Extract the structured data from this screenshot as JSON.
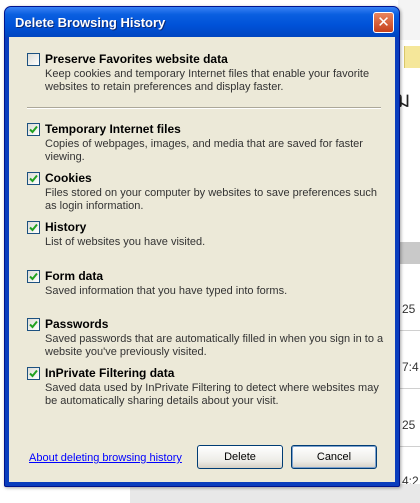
{
  "dialog": {
    "title": "Delete Browsing History",
    "close_symbol": "✕",
    "options": [
      {
        "label": "Preserve Favorites website data",
        "checked": false,
        "description": "Keep cookies and temporary Internet files that enable your favorite websites to retain preferences and display faster."
      },
      {
        "label": "Temporary Internet files",
        "checked": true,
        "description": "Copies of webpages, images, and media that are saved for faster viewing."
      },
      {
        "label": "Cookies",
        "checked": true,
        "description": "Files stored on your computer by websites to save preferences such as login information."
      },
      {
        "label": "History",
        "checked": true,
        "description": "List of websites you have visited."
      },
      {
        "label": "Form data",
        "checked": true,
        "description": "Saved information that you have typed into forms."
      },
      {
        "label": "Passwords",
        "checked": true,
        "description": "Saved passwords that are automatically filled in when you sign in to a website you've previously visited."
      },
      {
        "label": "InPrivate Filtering data",
        "checked": true,
        "description": "Saved data used by InPrivate Filtering to detect where websites may be automatically sharing details about your visit."
      }
    ],
    "help_link": "About deleting browsing history",
    "delete_label": "Delete",
    "cancel_label": "Cancel"
  },
  "background": {
    "heading_fragment": "ม",
    "rows": [
      "25",
      "7:4",
      "25",
      "4:2"
    ]
  },
  "colors": {
    "title_bar": "#0052d8",
    "dialog_face": "#ece9d8",
    "link": "#0000ff",
    "close_button": "#c6401c"
  }
}
